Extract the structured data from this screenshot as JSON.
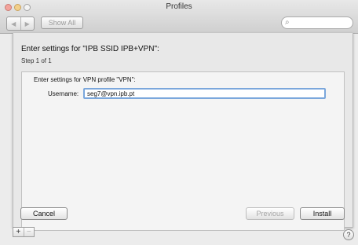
{
  "window": {
    "title": "Profiles"
  },
  "toolbar": {
    "back_icon": "◀",
    "forward_icon": "▶",
    "show_all_label": "Show All",
    "search_icon": "⌕",
    "search_value": ""
  },
  "sheet": {
    "heading": "Enter settings for \"IPB SSID IPB+VPN\":",
    "step": "Step 1 of 1",
    "vpn_heading": "Enter settings for VPN profile \"VPN\":",
    "username_label": "Username:",
    "username_value": "seg7@vpn.ipb.pt",
    "cancel_label": "Cancel",
    "previous_label": "Previous",
    "install_label": "Install"
  },
  "footer": {
    "add_label": "+",
    "remove_label": "−",
    "help_label": "?"
  },
  "colors": {
    "close": "#f3a39c",
    "minimize": "#f2cf8a",
    "focus_ring": "#7ba7dc"
  }
}
